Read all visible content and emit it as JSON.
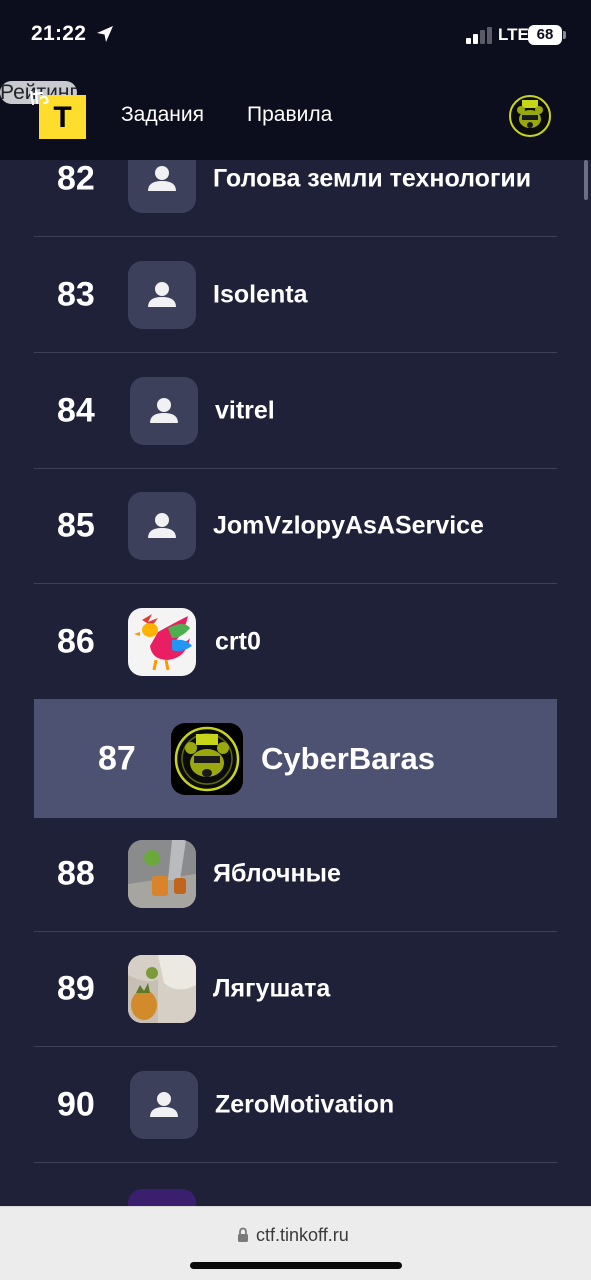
{
  "status_bar": {
    "time": "21:22",
    "network": "LTE",
    "battery": "68",
    "icons": [
      "location-arrow-icon",
      "signal-icon"
    ]
  },
  "nav": {
    "logo_letter": "Т",
    "logo_script": "IT's",
    "links": [
      {
        "label": "Задания",
        "active": false
      },
      {
        "label": "Правила",
        "active": false
      },
      {
        "label": "Рейтинг",
        "active": true
      }
    ]
  },
  "leaderboard": {
    "rows": [
      {
        "rank": "82",
        "name": "Голова земли технологии",
        "avatar": "default-user-icon"
      },
      {
        "rank": "83",
        "name": "Isolenta",
        "avatar": "default-user-icon"
      },
      {
        "rank": "84",
        "name": "vitrel",
        "avatar": "default-user-icon"
      },
      {
        "rank": "85",
        "name": "JomVzlopyAsAService",
        "avatar": "default-user-icon"
      },
      {
        "rank": "86",
        "name": "crt0",
        "avatar": "rooster-image"
      },
      {
        "rank": "87",
        "name": "CyberBaras",
        "avatar": "cyber-bear-logo",
        "highlighted": true
      },
      {
        "rank": "88",
        "name": "Яблочные",
        "avatar": "apple-drink-photo"
      },
      {
        "rank": "89",
        "name": "Лягушата",
        "avatar": "frog-photo"
      },
      {
        "rank": "90",
        "name": "ZeroMotivation",
        "avatar": "default-user-icon"
      }
    ]
  },
  "browser": {
    "url": "ctf.tinkoff.ru"
  },
  "colors": {
    "background": "#1f2139",
    "header": "#0c0d1d",
    "highlight_row": "#4e5272",
    "brand_yellow": "#ffdd2d",
    "avatar_placeholder": "#3c405a"
  }
}
